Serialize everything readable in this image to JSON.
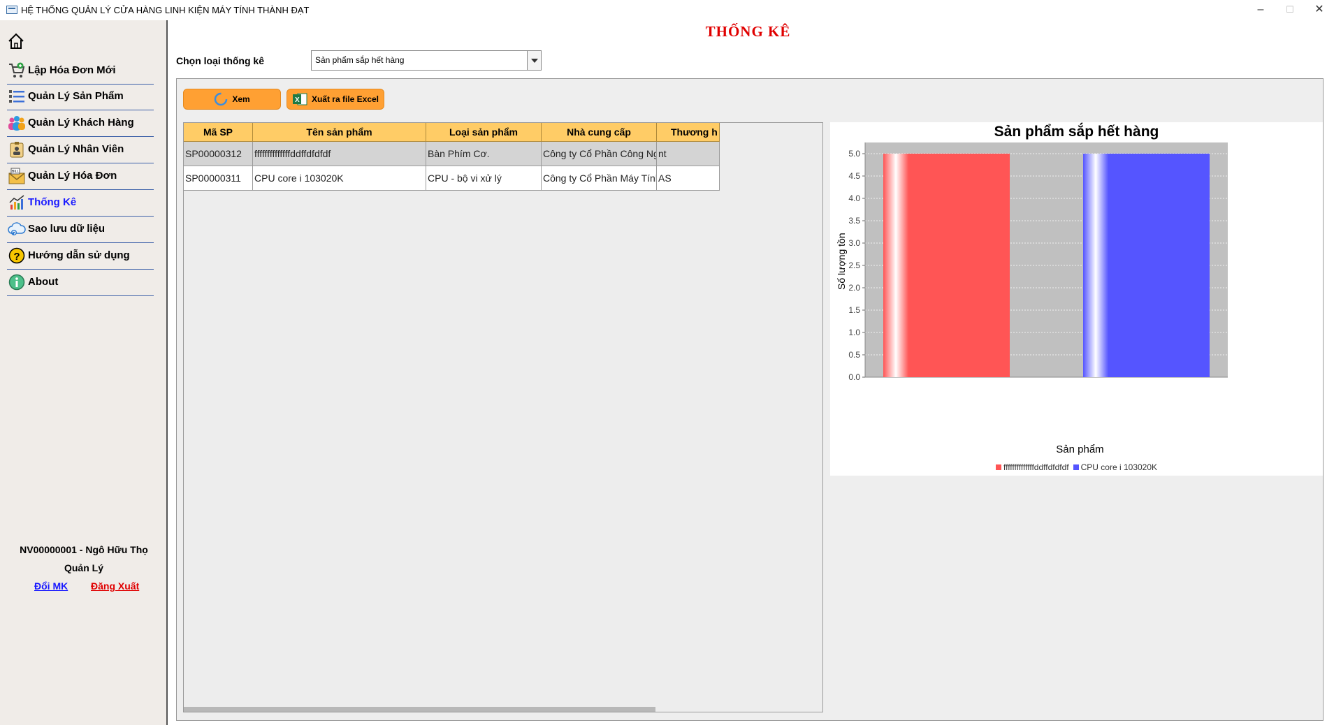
{
  "window": {
    "title": "HỆ THỐNG QUẢN LÝ CỬA HÀNG LINH KIỆN MÁY TÍNH THÀNH ĐẠT",
    "minimize": "–",
    "maximize": "☐",
    "close": "✕"
  },
  "sidebar": {
    "items": [
      {
        "label": "Lập Hóa Đơn Mới",
        "icon": "cart-add-icon"
      },
      {
        "label": "Quản Lý Sản Phẩm",
        "icon": "list-icon"
      },
      {
        "label": "Quản Lý Khách Hàng",
        "icon": "users-icon"
      },
      {
        "label": "Quản Lý Nhân Viên",
        "icon": "employee-badge-icon"
      },
      {
        "label": "Quản Lý Hóa Đơn",
        "icon": "bill-icon"
      },
      {
        "label": "Thống Kê",
        "icon": "chart-icon"
      },
      {
        "label": "Sao lưu dữ liệu",
        "icon": "cloud-backup-icon"
      },
      {
        "label": "Hướng dẫn sử dụng",
        "icon": "help-icon"
      },
      {
        "label": "About",
        "icon": "info-icon"
      }
    ],
    "active_index": 5,
    "user": {
      "name_line": "NV00000001 - Ngô Hữu  Thọ",
      "role": "Quản Lý",
      "change_password": "Đổi MK",
      "logout": "Đăng Xuất"
    }
  },
  "main": {
    "title": "THỐNG KÊ",
    "filter_label": "Chọn loại thống kê",
    "filter_value": "Sản phẩm sắp hết hàng",
    "view_button": "Xem",
    "export_button": "Xuất ra file Excel",
    "table": {
      "columns": [
        "Mã SP",
        "Tên sản phẩm",
        "Loại sản phẩm",
        "Nhà cung cấp",
        "Thương h"
      ],
      "rows": [
        [
          "SP00000312",
          "ffffffffffffffddffdfdfdf",
          "Bàn Phím Cơ.",
          "Công ty Cổ Phần Công Nghệ...",
          "nt"
        ],
        [
          "SP00000311",
          "CPU core i 103020K",
          "CPU - bộ vi xử lý",
          "Công ty Cổ Phần Máy Tính H...",
          "AS"
        ]
      ]
    }
  },
  "chart_data": {
    "type": "bar",
    "title": "Sản phẩm sắp hết hàng",
    "xlabel": "Sản phẩm",
    "ylabel": "Số lượng tồn",
    "ylim": [
      0,
      5
    ],
    "yticks": [
      "0.0",
      "0.5",
      "1.0",
      "1.5",
      "2.0",
      "2.5",
      "3.0",
      "3.5",
      "4.0",
      "4.5",
      "5.0"
    ],
    "series": [
      {
        "name": "ffffffffffffffddffdfdfdf",
        "values": [
          5
        ],
        "color": "#ff5555"
      },
      {
        "name": "CPU core i 103020K",
        "values": [
          5
        ],
        "color": "#5555ff"
      }
    ],
    "legend": "bottom",
    "grid": true
  }
}
